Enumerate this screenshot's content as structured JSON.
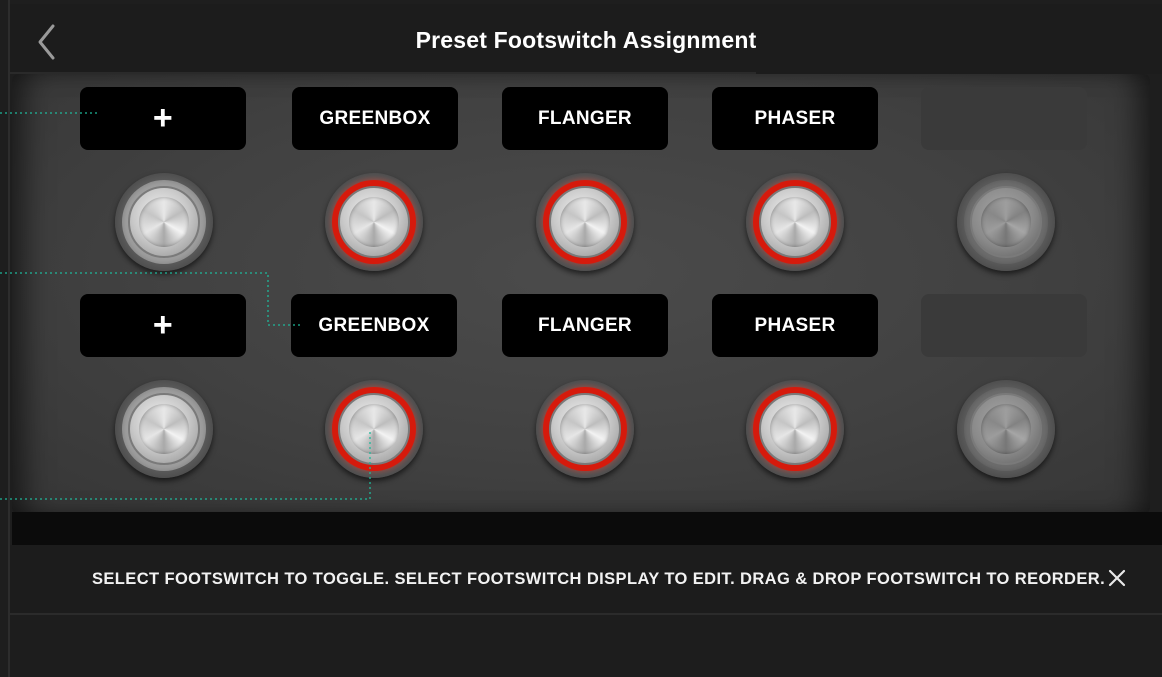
{
  "header": {
    "title": "Preset Footswitch Assignment",
    "back_icon": "chevron-left-icon"
  },
  "rows": [
    {
      "displays": [
        "+",
        "GREENBOX",
        "FLANGER",
        "PHASER",
        ""
      ],
      "footswitch_states": [
        "off",
        "on",
        "on",
        "on",
        "off-dim"
      ]
    },
    {
      "displays": [
        "+",
        "GREENBOX",
        "FLANGER",
        "PHASER",
        ""
      ],
      "footswitch_states": [
        "off",
        "on",
        "on",
        "on",
        "off-dim"
      ]
    }
  ],
  "info_bar": {
    "text": "SELECT FOOTSWITCH TO TOGGLE. SELECT FOOTSWITCH DISPLAY TO EDIT. DRAG & DROP FOOTSWITCH TO REORDER.",
    "close_icon": "close-icon"
  },
  "colors": {
    "footswitch_on_ring": "#d61a0c",
    "guide_line": "#1fb89a",
    "display_bg": "#000000",
    "empty_display_bg": "#3a3a3a"
  }
}
